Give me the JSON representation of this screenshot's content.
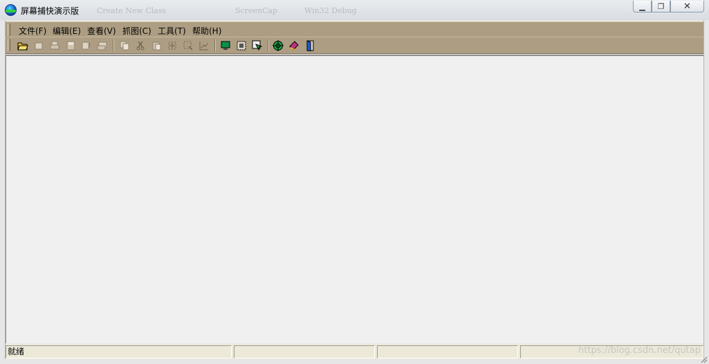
{
  "window": {
    "title": "屏幕捕快演示版",
    "background_toolbar_ghost": [
      "Create New Class",
      "ScreenCap",
      "Win32 Debug"
    ],
    "controls": {
      "minimize_icon": "minimize-icon",
      "restore_icon": "restore-icon",
      "close_icon": "close-icon"
    }
  },
  "menu": [
    {
      "label": "文件(F)"
    },
    {
      "label": "编辑(E)"
    },
    {
      "label": "查看(V)"
    },
    {
      "label": "抓图(C)"
    },
    {
      "label": "工具(T)"
    },
    {
      "label": "帮助(H)"
    }
  ],
  "toolbar": {
    "buttons": [
      "open-folder-icon",
      "new-icon",
      "print-icon",
      "save-icon",
      "help-query-icon",
      "print-preview-icon",
      "copy-icon",
      "cut-icon",
      "paste-icon",
      "select-region-icon",
      "select-window-icon",
      "chart-icon",
      "monitor-icon",
      "fullscreen-capture-icon",
      "cursor-capture-icon",
      "target-icon",
      "book-icon",
      "exit-door-icon"
    ]
  },
  "status": {
    "text": "就绪",
    "panes": [
      "",
      "",
      ""
    ],
    "watermark": "https://blog.csdn.net/qutap"
  },
  "colors": {
    "toolbar_bg": "#ad9e83",
    "client_bg": "#f0f0f0"
  }
}
